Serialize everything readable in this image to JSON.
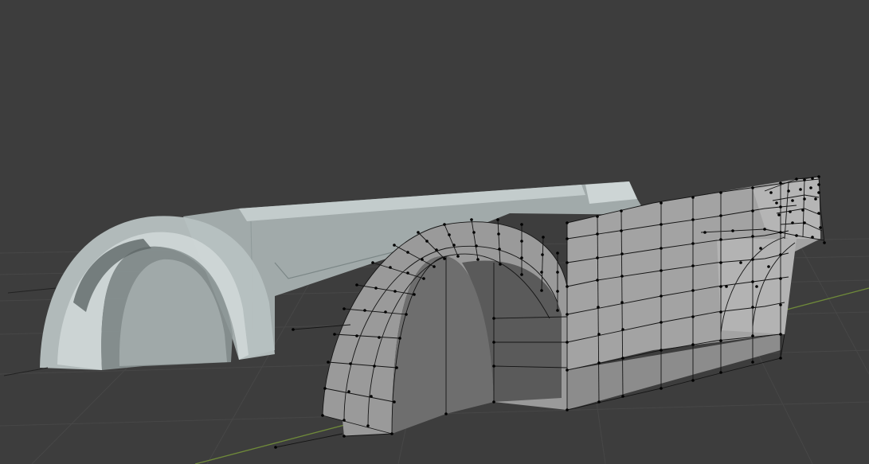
{
  "viewport": {
    "background": "#3d3d3d",
    "grid_color": "#474747",
    "x_axis_color": "#6f8a3a",
    "ghost_mesh_color": "#b8c2c2",
    "edit_mesh_face_color": "#8e8e8e",
    "edit_mesh_wire_color": "#111111",
    "vertex_color": "#000000"
  }
}
